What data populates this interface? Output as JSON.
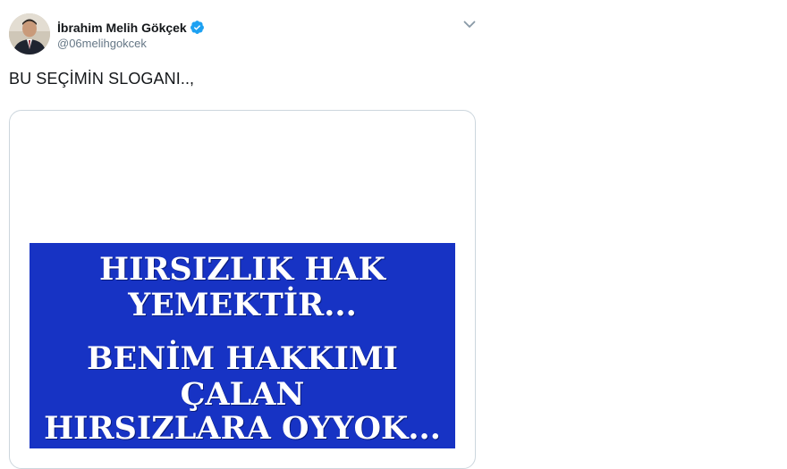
{
  "author": {
    "display_name": "İbrahim Melih Gökçek",
    "handle": "@06melihgokcek",
    "verified": true,
    "verified_icon": "verified-badge-icon",
    "avatar_icon": "profile-photo"
  },
  "menu": {
    "icon": "chevron-down-icon"
  },
  "tweet": {
    "text": "BU SEÇİMİN SLOGANI..,"
  },
  "media": {
    "banner_color": "#1733c4",
    "lines": [
      "HIRSIZLIK HAK",
      "YEMEKTİR...",
      "BENİM HAKKIMI",
      "ÇALAN",
      "HIRSIZLARA OYYOK..."
    ]
  },
  "colors": {
    "verified_blue": "#1da1f2",
    "text_primary": "#14171a",
    "text_secondary": "#657786",
    "card_border": "#ccd6dd"
  }
}
